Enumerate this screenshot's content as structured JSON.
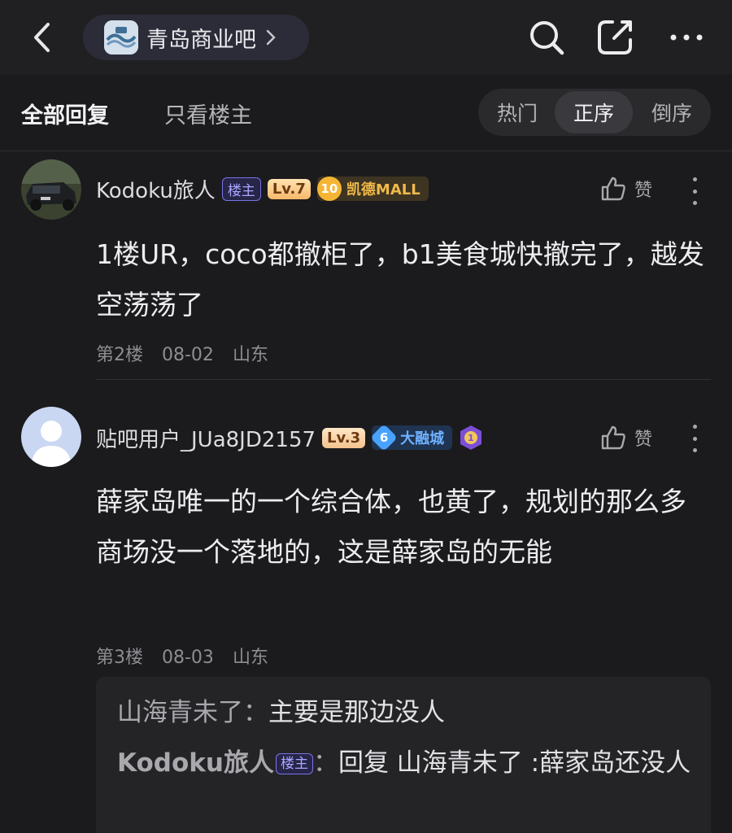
{
  "nav": {
    "forum_name": "青岛商业吧"
  },
  "filter": {
    "tab_all": "全部回复",
    "tab_op_only": "只看楼主",
    "sort_hot": "热门",
    "sort_asc": "正序",
    "sort_desc": "倒序"
  },
  "posts": [
    {
      "username": "Kodoku旅人",
      "op_badge": "楼主",
      "level": "Lv.7",
      "forum_badge_num": "10",
      "forum_badge_text": "凯德MALL",
      "like_label": "赞",
      "content": "1楼UR，coco都撤柜了，b1美食城快撤完了，越发空荡荡了",
      "floor": "第2楼",
      "date": "08-02",
      "location": "山东"
    },
    {
      "username": "贴吧用户_JUa8JD2157",
      "level": "Lv.3",
      "forum_badge_num": "6",
      "forum_badge_text": "大融城",
      "like_label": "赞",
      "content": "薛家岛唯一的一个综合体，也黄了，规划的那么多商场没一个落地的，这是薛家岛的无能",
      "floor": "第3楼",
      "date": "08-03",
      "location": "山东",
      "replies": [
        {
          "name": "山海青未了",
          "sep": "：",
          "text": "主要是那边没人"
        },
        {
          "name": "Kodoku旅人",
          "badge": "楼主",
          "sep": "：",
          "text": "回复 山海青未了 :薛家岛还没人"
        }
      ]
    }
  ],
  "colors": {
    "background": "#1b1b1d",
    "topbar": "#202023",
    "op_badge": "#7a73e6",
    "gold_badge": "#f0b94a",
    "blue_badge": "#6fb1ff"
  },
  "icons": [
    "back-arrow-icon",
    "forum-logo-icon",
    "chevron-right-icon",
    "search-icon",
    "share-icon",
    "more-icon",
    "thumbs-up-icon",
    "vertical-dots-icon",
    "medal-icon"
  ]
}
